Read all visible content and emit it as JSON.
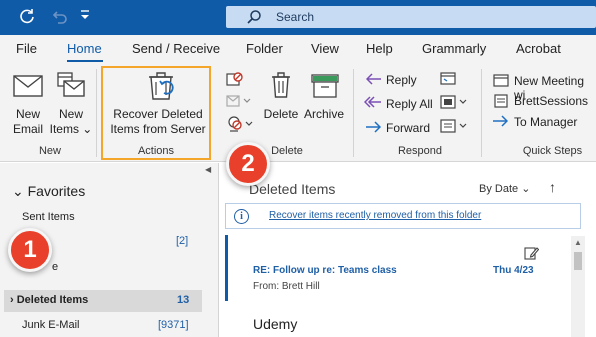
{
  "titlebar": {
    "sync_icon": "sync-icon",
    "undo_icon": "undo-icon",
    "customize_icon": "customize-quick-access-icon",
    "search_placeholder": "Search"
  },
  "menu_tabs": [
    "File",
    "Home",
    "Send / Receive",
    "Folder",
    "View",
    "Help",
    "Grammarly",
    "Acrobat"
  ],
  "menu_active": "Home",
  "ribbon": {
    "new_email": "New\nEmail",
    "new_email_l1": "New",
    "new_email_l2": "Email",
    "new_items_l1": "New",
    "new_items_l2": "Items",
    "group_new": "New",
    "recover_l1": "Recover Deleted",
    "recover_l2": "Items from Server",
    "group_actions": "Actions",
    "delete": "Delete",
    "archive": "Archive",
    "group_delete": "Delete",
    "reply": "Reply",
    "reply_all": "Reply All",
    "forward": "Forward",
    "group_respond": "Respond",
    "quick_steps": [
      "New Meeting wi",
      "BrettSessions",
      "To Manager"
    ],
    "group_quick_steps": "Quick Steps"
  },
  "callouts": {
    "one": "1",
    "two": "2"
  },
  "folders": {
    "favorites_title": "Favorites",
    "sent": "Sent Items",
    "sent_count": "[2]",
    "partial_item": "e",
    "deleted": "Deleted Items",
    "deleted_count": "13",
    "junk": "Junk E-Mail",
    "junk_count": "[9371]"
  },
  "message_list": {
    "title": "Deleted Items",
    "sort_label": "By Date",
    "info_text": "Recover items recently removed from this folder",
    "subject": "RE: Follow up re: Teams class",
    "date": "Thu 4/23",
    "from": "From: Brett Hill",
    "next_sender": "Udemy"
  },
  "colors": {
    "accent": "#0f5ba8",
    "highlight": "#f3a62a",
    "callout": "#e8402a"
  }
}
